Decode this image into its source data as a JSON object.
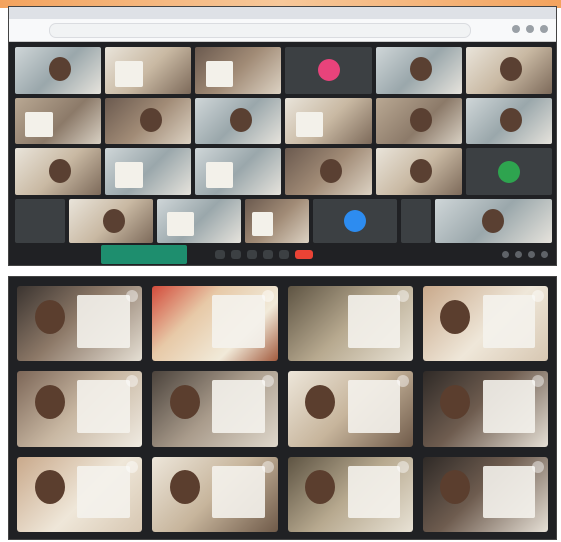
{
  "top_screenshot": {
    "browser": {
      "url": ""
    },
    "grid_rows": 3,
    "grid_cols": 6,
    "control_bar": {
      "time_text": "",
      "green_button_text": ""
    }
  },
  "bottom_screenshot": {
    "tiles": [
      {
        "name": ""
      },
      {
        "name": ""
      },
      {
        "name": ""
      },
      {
        "name": ""
      },
      {
        "name": ""
      },
      {
        "name": ""
      },
      {
        "name": ""
      },
      {
        "name": ""
      },
      {
        "name": ""
      },
      {
        "name": ""
      },
      {
        "name": ""
      },
      {
        "name": ""
      }
    ]
  },
  "colors": {
    "meet_dark": "#202124",
    "end_call_red": "#ea4335",
    "present_green": "#1e8e6e",
    "avatar_pink": "#e8437b",
    "avatar_blue": "#2d8cf0",
    "avatar_green": "#2ea44f"
  },
  "icons": [
    "mic-icon",
    "camera-icon",
    "captions-icon",
    "present-icon",
    "more-icon",
    "end-call-icon",
    "info-icon",
    "people-icon",
    "chat-icon",
    "activities-icon",
    "options-icon"
  ]
}
